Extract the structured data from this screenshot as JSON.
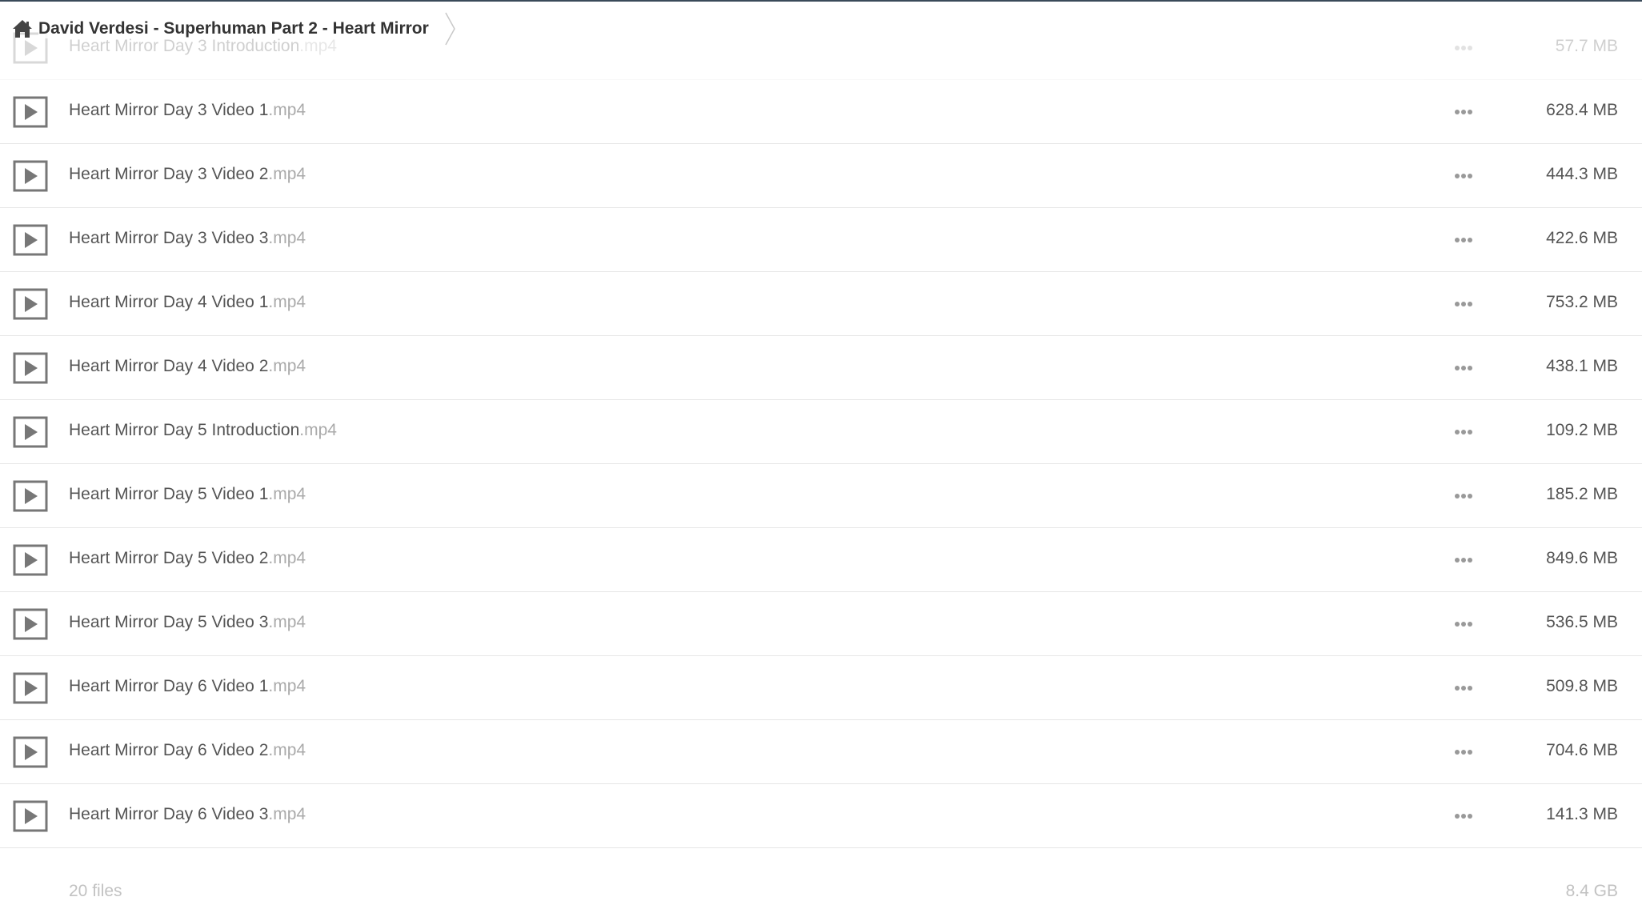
{
  "breadcrumb": {
    "label": "David Verdesi - Superhuman Part 2 - Heart Mirror",
    "home_icon": "home-icon",
    "separator_icon": "chevron-right-icon"
  },
  "files": [
    {
      "name": "Heart Mirror Day 3 Introduction",
      "ext": ".mp4",
      "size": "57.7 MB",
      "faded": true
    },
    {
      "name": "Heart Mirror Day 3 Video 1",
      "ext": ".mp4",
      "size": "628.4 MB"
    },
    {
      "name": "Heart Mirror Day 3 Video 2",
      "ext": ".mp4",
      "size": "444.3 MB"
    },
    {
      "name": "Heart Mirror Day 3 Video 3",
      "ext": ".mp4",
      "size": "422.6 MB"
    },
    {
      "name": "Heart Mirror Day 4 Video 1",
      "ext": ".mp4",
      "size": "753.2 MB"
    },
    {
      "name": "Heart Mirror Day 4 Video 2",
      "ext": ".mp4",
      "size": "438.1 MB"
    },
    {
      "name": "Heart Mirror Day 5 Introduction",
      "ext": ".mp4",
      "size": "109.2 MB"
    },
    {
      "name": "Heart Mirror Day 5 Video 1",
      "ext": ".mp4",
      "size": "185.2 MB"
    },
    {
      "name": "Heart Mirror Day 5 Video 2",
      "ext": ".mp4",
      "size": "849.6 MB"
    },
    {
      "name": "Heart Mirror Day 5 Video 3",
      "ext": ".mp4",
      "size": "536.5 MB"
    },
    {
      "name": "Heart Mirror Day 6 Video 1",
      "ext": ".mp4",
      "size": "509.8 MB"
    },
    {
      "name": "Heart Mirror Day 6 Video 2",
      "ext": ".mp4",
      "size": "704.6 MB"
    },
    {
      "name": "Heart Mirror Day 6 Video 3",
      "ext": ".mp4",
      "size": "141.3 MB"
    }
  ],
  "row_icons": {
    "file": "play-video-icon",
    "actions": "more-options-icon"
  },
  "footer": {
    "count": "20 files",
    "total": "8.4 GB"
  }
}
